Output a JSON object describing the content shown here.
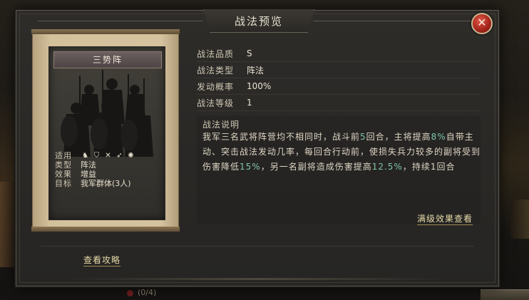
{
  "background": {
    "bottom_progress": "(0/4)"
  },
  "dialog": {
    "title": "战法预览",
    "close_symbol": "✕"
  },
  "card": {
    "name": "三势阵",
    "attributes": [
      {
        "key": "适用",
        "value": ""
      },
      {
        "key": "类型",
        "value": "阵法"
      },
      {
        "key": "效果",
        "value": "增益"
      },
      {
        "key": "目标",
        "value": "我军群体(3人)"
      }
    ],
    "applicable_icons": [
      "cavalry-icon",
      "shield-icon",
      "crossbow-icon",
      "spear-icon",
      "siege-icon"
    ]
  },
  "info": {
    "rows": [
      {
        "label": "战法品质",
        "value": "S"
      },
      {
        "label": "战法类型",
        "value": "阵法"
      },
      {
        "label": "发动概率",
        "value": "100%"
      },
      {
        "label": "战法等级",
        "value": "1"
      }
    ],
    "description_title": "战法说明",
    "description": {
      "p1": "我军三名武将阵营均不相同时，战斗前",
      "n1": "5",
      "p2": "回合，主将提高",
      "n2": "8%",
      "p3": "自带主动、突击战法发动几率，每回合行动前，使损失兵力较多的副将受到伤害降低",
      "n3": "15%",
      "p4": "，另一名副将造成伤害提高",
      "n4": "12.5%",
      "p5": "，持续1回合"
    }
  },
  "links": {
    "max_effect": "满级效果查看",
    "guide": "查看攻略"
  },
  "colors": {
    "highlight": "#7fc4a9",
    "link": "#e6d9a8",
    "close_red": "#a8261c"
  }
}
